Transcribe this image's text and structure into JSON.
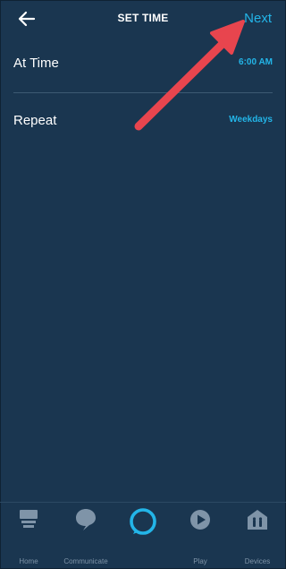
{
  "header": {
    "title": "SET TIME",
    "next_label": "Next"
  },
  "settings": [
    {
      "label": "At Time",
      "value": "6:00 AM"
    },
    {
      "label": "Repeat",
      "value": "Weekdays"
    }
  ],
  "bottom_nav": [
    {
      "label": "Home",
      "icon": "home-icon"
    },
    {
      "label": "Communicate",
      "icon": "chat-bubble-icon"
    },
    {
      "label": "",
      "icon": "alexa-ring-icon"
    },
    {
      "label": "Play",
      "icon": "play-icon"
    },
    {
      "label": "Devices",
      "icon": "devices-icon"
    }
  ],
  "colors": {
    "background": "#1a3650",
    "accent": "#23b5e8",
    "annotation_arrow": "#e8454e",
    "nav_icon": "#7f94a8"
  }
}
